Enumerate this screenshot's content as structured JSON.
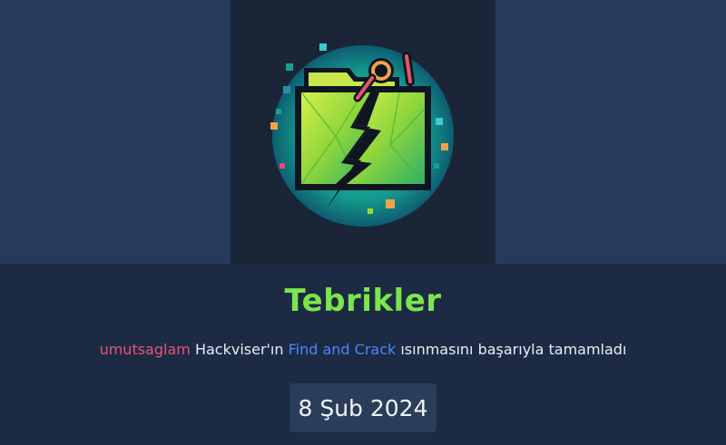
{
  "badge": {
    "icon": "folder-crack-icon",
    "colors": {
      "ring": "#1aa08c",
      "folder": "#9bdc34",
      "outline": "#0f1622",
      "key": "#f2a14a"
    }
  },
  "title": "Tebrikler",
  "message": {
    "username": "umutsaglam",
    "before_lab": " Hackviser'ın ",
    "lab_name": "Find and Crack",
    "after_lab": " ısınmasını başarıyla tamamladı"
  },
  "date": "8 Şub 2024",
  "colors": {
    "title": "#7be64b",
    "username": "#e9537a",
    "lab_link": "#4d84ff"
  }
}
